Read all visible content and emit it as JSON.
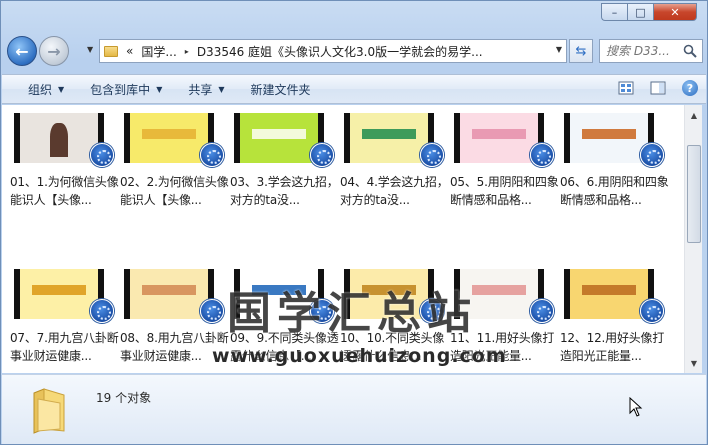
{
  "window": {
    "caption_min": "–",
    "caption_max": "□",
    "caption_close": "✕"
  },
  "nav": {
    "back": "←",
    "forward": "→",
    "history_drop": "▼",
    "breadcrumb": [
      "«",
      "国学...",
      "▸",
      "D33546 庭姐《头像识人文化3.0版一学就会的易学..."
    ],
    "refresh": "⇆",
    "search_placeholder": "搜索 D33..."
  },
  "toolbar": {
    "organize": "组织",
    "include_library": "包含到库中",
    "share": "共享",
    "new_folder": "新建文件夹",
    "dropdown_glyph": "▼"
  },
  "files": [
    {
      "name": "01、1.为何微信头像能识人【头像...",
      "thumb": "woman",
      "accent": "#9c7c6a"
    },
    {
      "name": "02、2.为何微信头像能识人【头像...",
      "thumb": "yellowdoc",
      "accent": "#f2d84a"
    },
    {
      "name": "03、3.学会这九招，对方的ta没...",
      "thumb": "green",
      "accent": "#b8e23a"
    },
    {
      "name": "04、4.学会这九招，对方的ta没...",
      "thumb": "icons",
      "accent": "#f3e98a"
    },
    {
      "name": "05、5.用阴阳和四象断情感和品格...",
      "thumb": "pink",
      "accent": "#f6c7d4"
    },
    {
      "name": "06、6.用阴阳和四象断情感和品格...",
      "thumb": "photos",
      "accent": "#eef4f8"
    },
    {
      "name": "07、7.用九宫八卦断事业财运健康...",
      "thumb": "yellowtitle",
      "accent": "#fbe892"
    },
    {
      "name": "08、8.用九宫八卦断事业财运健康...",
      "thumb": "palm",
      "accent": "#f7e6a4"
    },
    {
      "name": "09、9.不同类头像透露什么信息【...",
      "thumb": "table",
      "accent": "#ffffff"
    },
    {
      "name": "10、10.不同类头像透露什么信息...",
      "thumb": "list",
      "accent": "#fbe8a0"
    },
    {
      "name": "11、11.用好头像打造阳光正能量...",
      "thumb": "white",
      "accent": "#f4f1ec"
    },
    {
      "name": "12、12.用好头像打造阳光正能量...",
      "thumb": "sunset",
      "accent": "#f6d36a"
    }
  ],
  "watermark": {
    "title": "国学汇总站",
    "url": "www.guoxuehuizong.com"
  },
  "details": {
    "count": "19 个对象"
  },
  "scroll": {
    "up": "▲",
    "down": "▼"
  }
}
